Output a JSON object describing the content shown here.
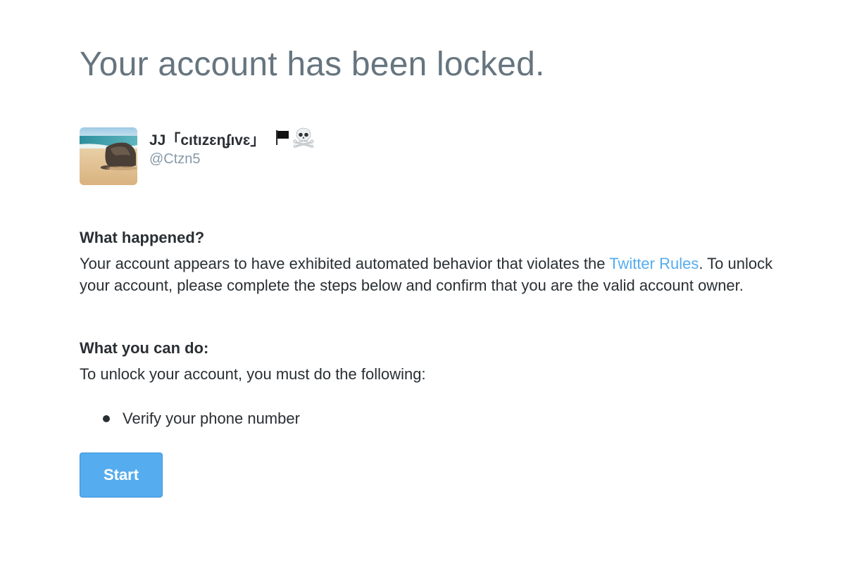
{
  "page": {
    "headline": "Your account has been locked."
  },
  "account": {
    "display_name": "JJ「cıtızɛɳʄıvɛ」",
    "handle": "@Ctzn5",
    "name_icons": [
      "black-flag-icon",
      "skull-crossbones-icon"
    ]
  },
  "what_happened": {
    "title": "What happened?",
    "text_before_link": "Your account appears to have exhibited automated behavior that violates the ",
    "link_label": "Twitter Rules",
    "text_after_link": ". To unlock your account, please complete the steps below and confirm that you are the valid account owner."
  },
  "what_you_can_do": {
    "title": "What you can do:",
    "intro": "To unlock your account, you must do the following:",
    "steps": [
      "Verify your phone number"
    ]
  },
  "actions": {
    "start_label": "Start"
  },
  "colors": {
    "headline": "#66757f",
    "text": "#292f33",
    "link": "#55acee",
    "button": "#55acee",
    "handle": "#8899a6"
  }
}
